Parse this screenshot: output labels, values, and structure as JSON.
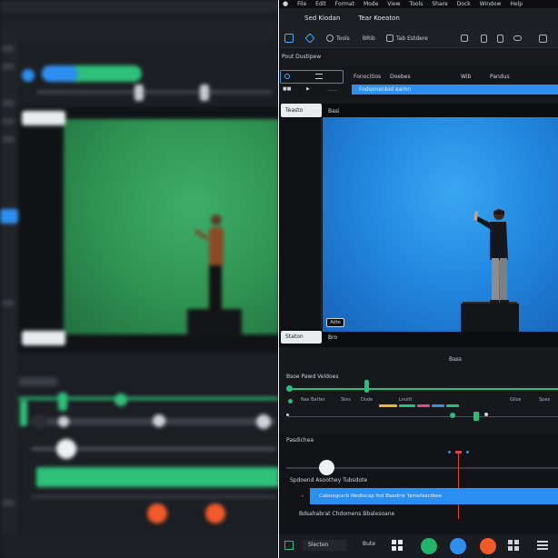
{
  "menu": {
    "items": [
      "File",
      "Edit",
      "Format",
      "Mode",
      "View",
      "Tools",
      "Share",
      "Dock",
      "Window",
      "Help"
    ]
  },
  "titlebar": {
    "left": "Sed Kiodan",
    "right": "Tear Koeaton"
  },
  "toolbar": {
    "items": [
      "",
      "",
      "Tools",
      "BRib",
      "Tab Estdere",
      "",
      "",
      "",
      "",
      ""
    ]
  },
  "tracks": {
    "heading": "Pout Dustipew",
    "search": "",
    "columns": [
      "Fonocitios",
      "Doebes",
      "Wib",
      "Pandus"
    ],
    "selected_row": "Fodsonenbid eamn"
  },
  "preview": {
    "tab_label": "Teasto",
    "header_label": "Basi",
    "small_button": "Adte",
    "stat_tab": "Staton",
    "stat_label": "Bro"
  },
  "timeline": {
    "heading": "Bass",
    "row_label": "Bsoe Pawd Veldoes",
    "track_label": "Nas Batter",
    "ticks": [
      "Stes",
      "Dode",
      "Lnuitt",
      "Gilos",
      "Spex"
    ]
  },
  "audio": {
    "title": "Pasdichea",
    "row1_label": "Spdoend Asoothey Tubsdote",
    "caption": "Cabnegcarb Nedtscap fod Baadrre Yamefasctbee",
    "row3_label": "Bdsahabrat Chdomens Bbalesoane"
  },
  "bottom": {
    "item1": "Slecten",
    "item2": "Bute"
  },
  "colors": {
    "accent_blue": "#2e8ff0",
    "green_track": "#22c07a",
    "playhead_red": "#e2403b",
    "btn_green": "#22b36b",
    "btn_blue": "#2f8ff0",
    "btn_orange": "#f05a2a"
  }
}
